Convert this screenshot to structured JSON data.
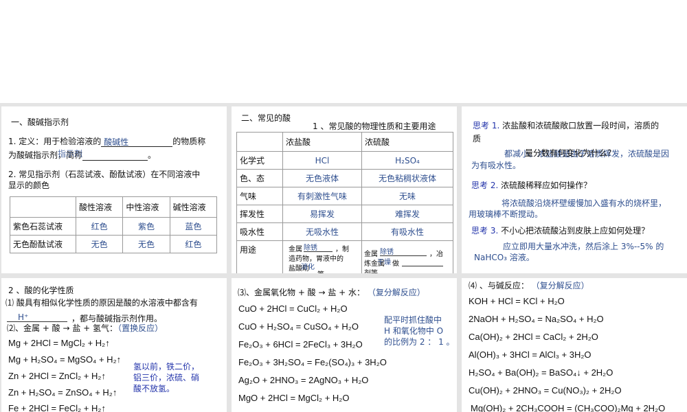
{
  "p1": {
    "title": "一、酸碱指示剂",
    "def_a": "1. 定义：用于检验溶液的",
    "def_ans": "酸碱性",
    "def_b": "的物质称",
    "def_c": "为酸碱指示剂，简称",
    "def_ans2": "指示剂",
    "def_end": "。",
    "q2": "2. 常见指示剂（石蕊试液、酚酞试液）在不同溶液中",
    "q2b": "显示的颜色",
    "headers": [
      "",
      "酸性溶液",
      "中性溶液",
      "碱性溶液"
    ],
    "rows": [
      {
        "name": "紫色石蕊试液",
        "vals": [
          "红色",
          "紫色",
          "蓝色"
        ]
      },
      {
        "name": "无色酚酞试液",
        "vals": [
          "无色",
          "无色",
          "红色"
        ]
      }
    ]
  },
  "p2": {
    "title": "二、常见的酸",
    "subtitle": "1 、常见酸的物理性质和主要用途",
    "headers": [
      "",
      "浓盐酸",
      "浓硫酸"
    ],
    "rows": [
      {
        "name": "化学式",
        "vals": [
          "HCl",
          "H₂SO₄"
        ]
      },
      {
        "name": "色、态",
        "vals": [
          "无色液体",
          "无色粘稠状液体"
        ]
      },
      {
        "name": "气味",
        "vals": [
          "有刺激性气味",
          "无味"
        ]
      },
      {
        "name": "挥发性",
        "vals": [
          "易挥发",
          "难挥发"
        ]
      },
      {
        "name": "吸水性",
        "vals": [
          "无吸水性",
          "有吸水性"
        ]
      }
    ],
    "use_label": "用途",
    "use_hcl": [
      "金属",
      "除锈",
      "，制",
      "造药物，胃液中的",
      "盐酸助",
      "消化",
      "等。"
    ],
    "use_h2so4": [
      "金属",
      "除锈",
      "，冶",
      "炼金属",
      "干燥",
      "做",
      "剂等。"
    ]
  },
  "p3": {
    "q1_label": "思考 1.",
    "q1": "浓盐酸和浓硫酸敞口放置一段时间，溶质的",
    "q1b": "质",
    "q1c": "量分数有何变化为什么？",
    "a1a": "都减小。浓盐酸是由于溶质挥发，浓硫酸是因",
    "a1b": "为有吸水性。",
    "q2_label": "思考 2.",
    "q2": "浓硫酸稀释应如何操作？",
    "a2a": "将浓硫酸沿烧杯壁缓慢加入盛有水的烧杯里，",
    "a2b": "用玻璃棒不断搅动。",
    "q3_label": "思考 3.",
    "q3": "不小心把浓硫酸沾到皮肤上应如何处理？",
    "a3a": "应立即用大量水冲洗，然后涂上 3%--5% 的",
    "a3b": "NaHCO₃ 溶液。"
  },
  "p4": {
    "title": "2 、酸的化学性质",
    "l1": "⑴ 酸具有相似化学性质的原因是酸的水溶液中都含有",
    "ans": "H⁺",
    "l2": "，都与酸碱指示剂作用。",
    "l3": "⑵、金属  +  酸  →  盐  +  氢气：",
    "l3b": "（置换反应）",
    "eqs": [
      "Mg +  2HCl = MgCl₂ + H₂↑",
      "Mg + H₂SO₄ = MgSO₄ + H₂↑",
      "Zn +  2HCl = ZnCl₂ + H₂↑",
      "Zn + H₂SO₄ = ZnSO₄ + H₂↑",
      "Fe +  2HCl = FeCl₂ + H₂↑"
    ],
    "note": [
      "氢以前，铁二价，",
      "铝三价，浓硫、硝",
      "酸不放氢。"
    ]
  },
  "p5": {
    "title": "⑶、金属氧化物  +  酸  →  盐  +  水：",
    "title_b": "（复分解反应）",
    "eqs": [
      "CuO +  2HCl = CuCl₂ + H₂O",
      "CuO +  H₂SO₄ = CuSO₄ + H₂O",
      "Fe₂O₃ +  6HCl = 2FeCl₃ + 3H₂O",
      "Fe₂O₃ +  3H₂SO₄ = Fe₂(SO₄)₃ + 3H₂O",
      "Ag₂O +  2HNO₃ = 2AgNO₃ + H₂O",
      "MgO +  2HCl = MgCl₂ + H₂O"
    ],
    "note": [
      "配平时抓住酸中",
      "H 和氧化物中 O",
      "的比例为 2 ： 1 。"
    ]
  },
  "p6": {
    "title": "⑷ 、与碱反应：",
    "title_b": "（复分解反应）",
    "eqs": [
      "KOH + HCl = KCl + H₂O",
      "2NaOH + H₂SO₄ = Na₂SO₄ + H₂O",
      "Ca(OH)₂ + 2HCl = CaCl₂ + 2H₂O",
      "Al(OH)₃ + 3HCl = AlCl₃ + 3H₂O",
      "H₂SO₄ + Ba(OH)₂ = BaSO₄↓ + 2H₂O",
      "Cu(OH)₂ + 2HNO₃ = Cu(NO₃)₂ + 2H₂O",
      "Mg(OH)₂ + 2CH₃COOH = (CH₃COO)₂Mg + 2H₂O"
    ]
  }
}
